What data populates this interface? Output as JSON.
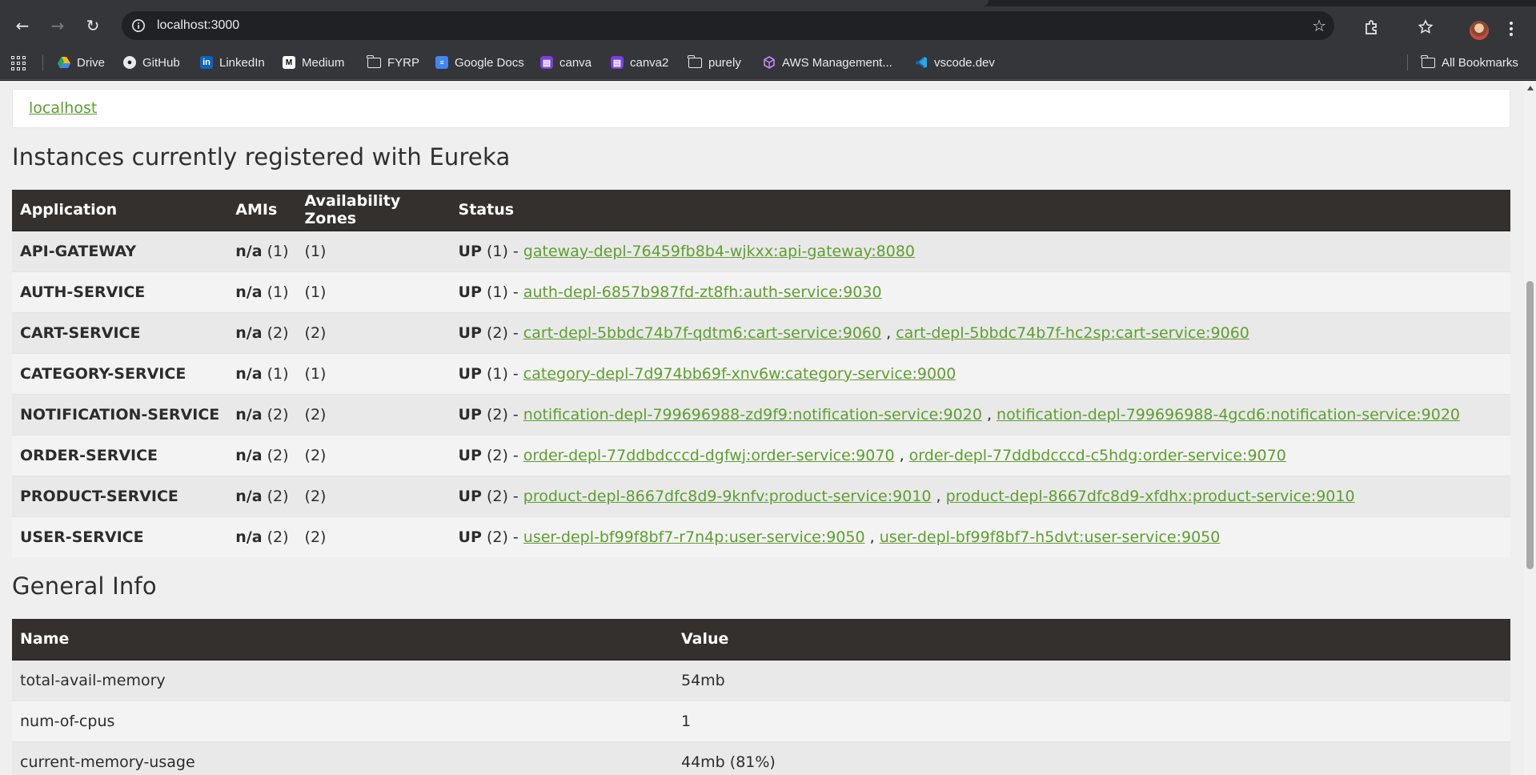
{
  "browser": {
    "url": "localhost:3000",
    "bookmarks": [
      {
        "label": "Drive",
        "icon": "drive-icon"
      },
      {
        "label": "GitHub",
        "icon": "github-icon"
      },
      {
        "label": "LinkedIn",
        "icon": "linkedin-icon"
      },
      {
        "label": "Medium",
        "icon": "medium-icon"
      },
      {
        "label": "FYRP",
        "icon": "folder-icon"
      },
      {
        "label": "Google Docs",
        "icon": "google-docs-icon"
      },
      {
        "label": "canva",
        "icon": "canva-icon"
      },
      {
        "label": "canva2",
        "icon": "canva-icon"
      },
      {
        "label": "purely",
        "icon": "folder-icon"
      },
      {
        "label": "AWS Management...",
        "icon": "aws-icon"
      },
      {
        "label": "vscode.dev",
        "icon": "vscode-icon"
      }
    ],
    "all_bookmarks": "All Bookmarks"
  },
  "page": {
    "host_link": "localhost",
    "instances_title": "Instances currently registered with Eureka",
    "instances_headers": [
      "Application",
      "AMIs",
      "Availability Zones",
      "Status"
    ],
    "instances": [
      {
        "app": "API-GATEWAY",
        "ami_na": "n/a",
        "ami_count": "(1)",
        "zones": "(1)",
        "status": "UP",
        "status_count": "(1) -",
        "links": [
          "gateway-depl-76459fb8b4-wjkxx:api-gateway:8080"
        ]
      },
      {
        "app": "AUTH-SERVICE",
        "ami_na": "n/a",
        "ami_count": "(1)",
        "zones": "(1)",
        "status": "UP",
        "status_count": "(1) -",
        "links": [
          "auth-depl-6857b987fd-zt8fh:auth-service:9030"
        ]
      },
      {
        "app": "CART-SERVICE",
        "ami_na": "n/a",
        "ami_count": "(2)",
        "zones": "(2)",
        "status": "UP",
        "status_count": "(2) -",
        "links": [
          "cart-depl-5bbdc74b7f-qdtm6:cart-service:9060",
          "cart-depl-5bbdc74b7f-hc2sp:cart-service:9060"
        ]
      },
      {
        "app": "CATEGORY-SERVICE",
        "ami_na": "n/a",
        "ami_count": "(1)",
        "zones": "(1)",
        "status": "UP",
        "status_count": "(1) -",
        "links": [
          "category-depl-7d974bb69f-xnv6w:category-service:9000"
        ]
      },
      {
        "app": "NOTIFICATION-SERVICE",
        "ami_na": "n/a",
        "ami_count": "(2)",
        "zones": "(2)",
        "status": "UP",
        "status_count": "(2) -",
        "links": [
          "notification-depl-799696988-zd9f9:notification-service:9020",
          "notification-depl-799696988-4gcd6:notification-service:9020"
        ]
      },
      {
        "app": "ORDER-SERVICE",
        "ami_na": "n/a",
        "ami_count": "(2)",
        "zones": "(2)",
        "status": "UP",
        "status_count": "(2) -",
        "links": [
          "order-depl-77ddbdcccd-dgfwj:order-service:9070",
          "order-depl-77ddbdcccd-c5hdg:order-service:9070"
        ]
      },
      {
        "app": "PRODUCT-SERVICE",
        "ami_na": "n/a",
        "ami_count": "(2)",
        "zones": "(2)",
        "status": "UP",
        "status_count": "(2) -",
        "links": [
          "product-depl-8667dfc8d9-9knfv:product-service:9010",
          "product-depl-8667dfc8d9-xfdhx:product-service:9010"
        ]
      },
      {
        "app": "USER-SERVICE",
        "ami_na": "n/a",
        "ami_count": "(2)",
        "zones": "(2)",
        "status": "UP",
        "status_count": "(2) -",
        "links": [
          "user-depl-bf99f8bf7-r7n4p:user-service:9050",
          "user-depl-bf99f8bf7-h5dvt:user-service:9050"
        ]
      }
    ],
    "general_title": "General Info",
    "general_headers": [
      "Name",
      "Value"
    ],
    "general_info": [
      {
        "name": "total-avail-memory",
        "value": "54mb"
      },
      {
        "name": "num-of-cpus",
        "value": "1"
      },
      {
        "name": "current-memory-usage",
        "value": "44mb (81%)"
      }
    ]
  },
  "colors": {
    "link": "#5e9e2e",
    "table_header": "#34302d",
    "page_bg": "#efefef",
    "chrome_bg": "#35363a"
  }
}
